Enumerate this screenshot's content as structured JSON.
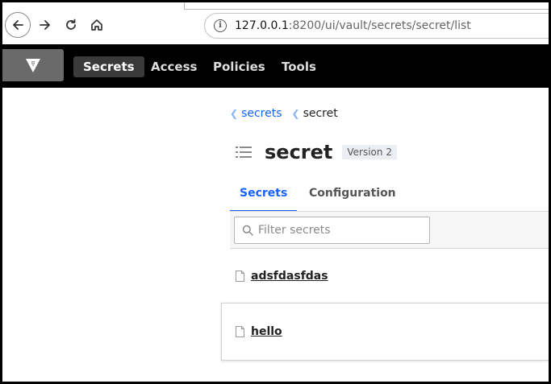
{
  "browser": {
    "url_host": "127.0.0.1",
    "url_rest": ":8200/ui/vault/secrets/secret/list",
    "icons": [
      "back-arrow-icon",
      "forward-arrow-icon",
      "reload-icon",
      "home-icon",
      "site-info-icon"
    ]
  },
  "header": {
    "logo_icon": "vault-logo-icon",
    "nav": [
      {
        "label": "Secrets",
        "active": true
      },
      {
        "label": "Access",
        "active": false
      },
      {
        "label": "Policies",
        "active": false
      },
      {
        "label": "Tools",
        "active": false
      }
    ],
    "colors": {
      "background": "#000000",
      "active_bg": "#3a3a3a"
    }
  },
  "breadcrumb": {
    "items": [
      {
        "label": "secrets",
        "link": true
      },
      {
        "label": "secret",
        "link": false
      }
    ]
  },
  "engine": {
    "title": "secret",
    "version_badge": "Version 2"
  },
  "tabs": [
    {
      "label": "Secrets",
      "active": true
    },
    {
      "label": "Configuration",
      "active": false
    }
  ],
  "filter": {
    "placeholder": "Filter secrets",
    "value": ""
  },
  "secrets": [
    {
      "name": "adsfdasfdas"
    },
    {
      "name": "hello"
    }
  ],
  "colors": {
    "accent": "#1563ff"
  }
}
